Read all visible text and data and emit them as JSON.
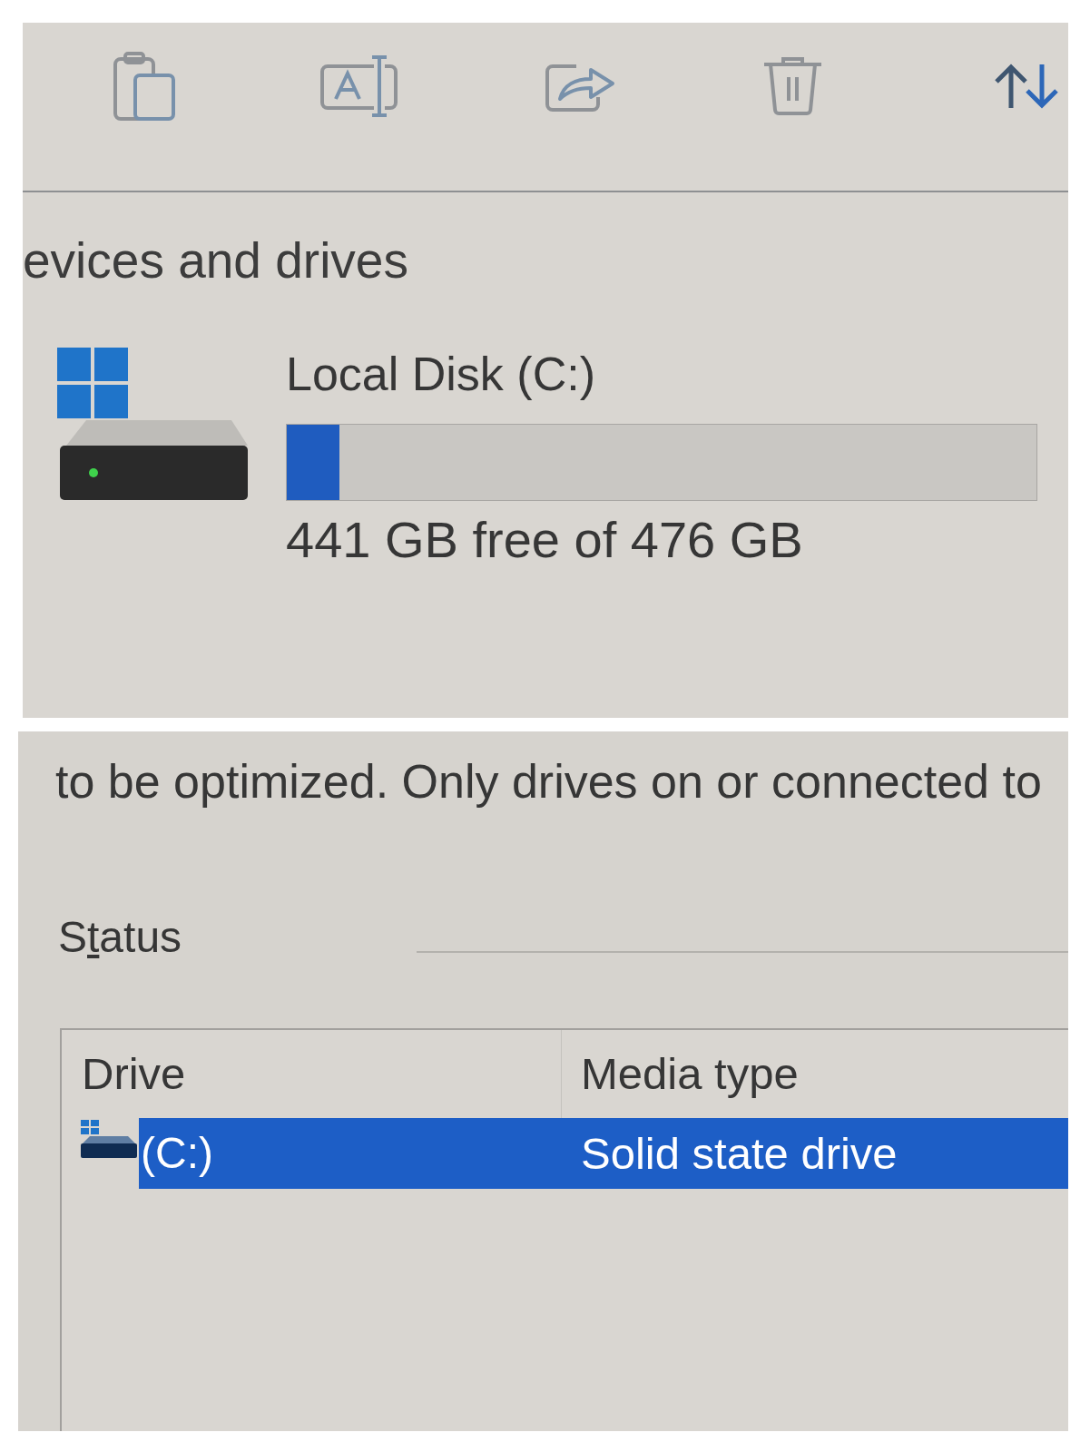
{
  "devices_and_drives": {
    "heading": "evices and drives",
    "drives": [
      {
        "name": "Local Disk (C:)",
        "level": 0.07,
        "reading": "441 GB free of 476 GB"
      }
    ]
  },
  "optimize_drives": {
    "description": "to be optimized. Only drives on or connected to",
    "status_label": "Status",
    "table": {
      "columns": [
        "Drive",
        "Media type"
      ],
      "rows": [
        {
          "cells": [
            "(C:)",
            "Solid state drive"
          ],
          "selected": true
        }
      ]
    }
  }
}
